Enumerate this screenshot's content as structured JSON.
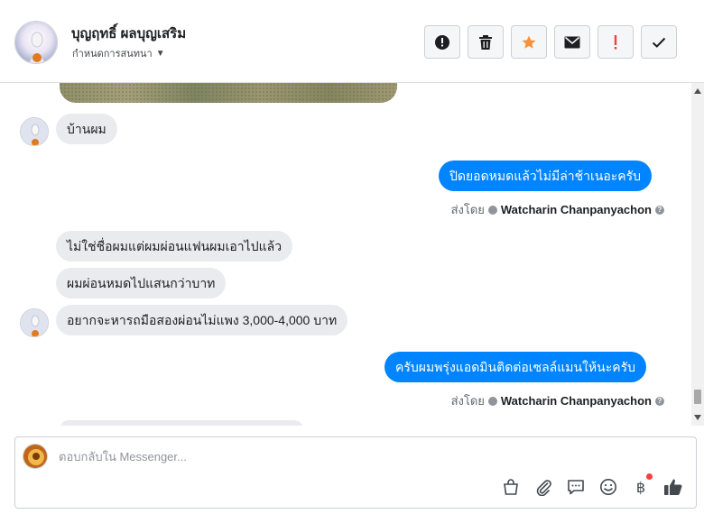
{
  "header": {
    "contact_name": "บุญฤทธิ์ ผลบุญเสริม",
    "conversation_settings": "กำหนดการสนทนา",
    "actions": [
      {
        "icon": "alert-circle-icon",
        "label": "mark-spam"
      },
      {
        "icon": "trash-icon",
        "label": "delete"
      },
      {
        "icon": "star-icon",
        "label": "star",
        "color": "#f7923b"
      },
      {
        "icon": "envelope-icon",
        "label": "mark-unread"
      },
      {
        "icon": "exclamation-icon",
        "label": "follow-up",
        "color": "#fa3e3e"
      },
      {
        "icon": "checkmark-icon",
        "label": "mark-done"
      }
    ]
  },
  "messages": {
    "m1": "บ้านผม",
    "m2": "ปิดยอดหมดแล้วไม่มีล่าช้าเนอะครับ",
    "m3": "ไม่ใช่ชื่อผมแต่ผมผ่อนแฟนผมเอาไปแล้ว",
    "m4": "ผมผ่อนหมดไปแสนกว่าบาท",
    "m5": "อยากจะหารถมือสองผ่อนไม่แพง 3,000-4,000 บาท",
    "m6": "ครับผมพรุ่งแอดมินติดต่อเซลล์แมนให้นะครับ",
    "sent_by_label": "ส่งโดย",
    "sender_name": "Watcharin Chanpanyachon"
  },
  "composer": {
    "placeholder": "ตอบกลับใน Messenger...",
    "tools": [
      "shopping-bag-icon",
      "paperclip-icon",
      "saved-reply-icon",
      "emoji-icon",
      "baht-payment-icon",
      "thumbs-up-icon"
    ],
    "baht_symbol": "฿"
  },
  "colors": {
    "outgoing_bubble": "#0084ff",
    "incoming_bubble": "#e9ebee",
    "like_icon": "#444950"
  }
}
